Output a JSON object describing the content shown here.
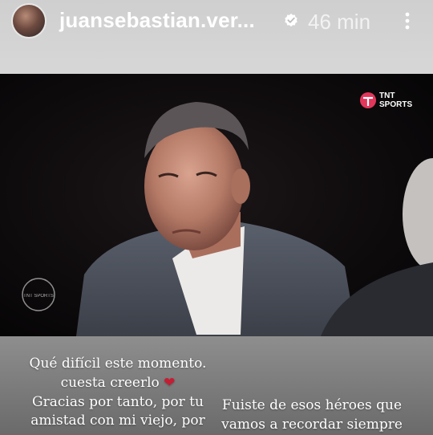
{
  "header": {
    "username": "juansebastian.ver...",
    "time": "46 min"
  },
  "video": {
    "channel_logo_text_line1": "TNT",
    "channel_logo_text_line2": "SPORTS",
    "watermark_text": "TNT SPORTS"
  },
  "captions": {
    "left_line1": "Qué difícil este momento.",
    "left_line2": "cuesta creerlo",
    "left_line3": "Gracias por tanto, por tu",
    "left_line4": "amistad con mi viejo, por",
    "right_line1": "Fuiste de esos héroes  que",
    "right_line2": "vamos a recordar siempre"
  },
  "colors": {
    "heart": "#c51d33",
    "logo_accent": "#e2365b"
  },
  "icons": [
    "verified-badge-icon",
    "more-options-icon",
    "broken-heart-icon",
    "tnt-sports-logo"
  ]
}
